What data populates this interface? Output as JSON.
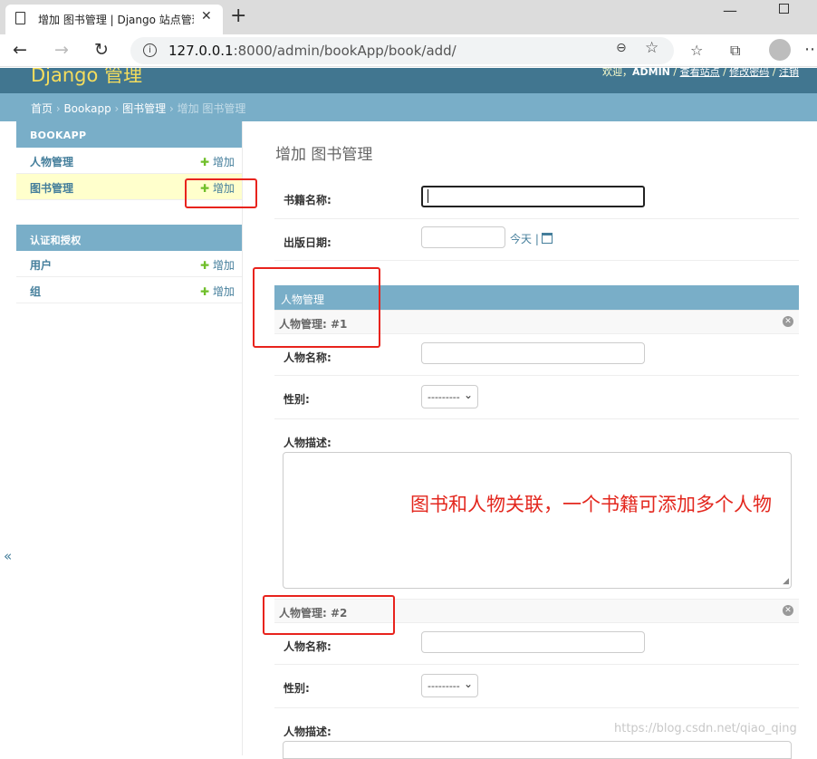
{
  "browser": {
    "tab_title": "增加 图书管理 | Django 站点管理",
    "tab_close": "✕",
    "new_tab": "+",
    "url_host": "127.0.0.1",
    "url_path": ":8000/admin/bookApp/book/add/",
    "win_min": "—"
  },
  "header": {
    "brand": "Django 管理",
    "welcome": "欢迎，",
    "username": "ADMIN",
    "view_site": "查看站点",
    "change_password": "修改密码",
    "logout": "注销",
    "sep": " / "
  },
  "breadcrumbs": {
    "home": "首页",
    "app": "Bookapp",
    "model": "图书管理",
    "current": "增加 图书管理",
    "sep": " › "
  },
  "sidebar": {
    "modules": [
      {
        "caption": "BOOKAPP",
        "items": [
          {
            "label": "人物管理",
            "add": "增加"
          },
          {
            "label": "图书管理",
            "add": "增加"
          }
        ]
      },
      {
        "caption": "认证和授权",
        "items": [
          {
            "label": "用户",
            "add": "增加"
          },
          {
            "label": "组",
            "add": "增加"
          }
        ]
      }
    ],
    "collapse": "«"
  },
  "form": {
    "title": "增加 图书管理",
    "fields": {
      "book_name_label": "书籍名称:",
      "book_name_value": "",
      "pub_date_label": "出版日期:",
      "pub_date_value": "",
      "today_link": "今天",
      "date_sep": "|"
    },
    "inline": {
      "caption": "人物管理",
      "entries": [
        {
          "heading": "人物管理: #1",
          "name_label": "人物名称:",
          "gender_label": "性别:",
          "gender_value": "---------",
          "desc_label": "人物描述:"
        },
        {
          "heading": "人物管理: #2",
          "name_label": "人物名称:",
          "gender_label": "性别:",
          "gender_value": "---------",
          "desc_label": "人物描述:"
        }
      ]
    }
  },
  "annotation": "图书和人物关联，一个书籍可添加多个人物",
  "watermark": "https://blog.csdn.net/qiao_qing",
  "colors": {
    "header": "#417690",
    "breadcrumbs": "#79aec8",
    "brand": "#f5dd5d",
    "annotation_red": "#e3271e",
    "link": "#447e9b",
    "add_plus": "#70bf2b"
  }
}
